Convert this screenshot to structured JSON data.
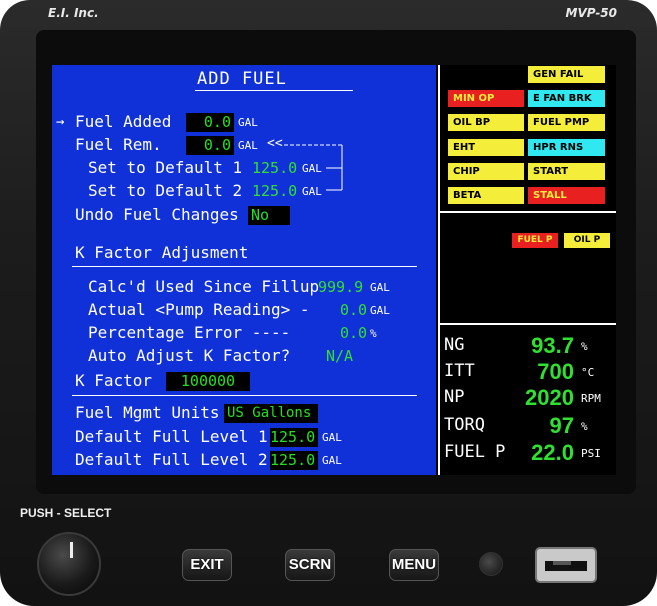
{
  "device": {
    "brand": "E.I. Inc.",
    "model": "MVP-50"
  },
  "screen": {
    "title": "ADD FUEL",
    "fuel_added": {
      "label": "Fuel Added",
      "value": "0.0",
      "unit": "GAL"
    },
    "fuel_rem": {
      "label": "Fuel Rem.",
      "value": "0.0",
      "unit": "GAL"
    },
    "default1": {
      "label": "Set to Default 1",
      "value": "125.0",
      "unit": "GAL"
    },
    "default2": {
      "label": "Set to Default 2",
      "value": "125.0",
      "unit": "GAL"
    },
    "undo": {
      "label": "Undo Fuel Changes",
      "value": "No"
    },
    "k_section": "K Factor Adjusment",
    "calcd": {
      "label": "Calc'd Used Since Fillup",
      "value": "999.9",
      "unit": "GAL"
    },
    "actual": {
      "label": "Actual <Pump Reading> -",
      "value": "0.0",
      "unit": "GAL"
    },
    "pct_err": {
      "label": "Percentage Error ----",
      "value": "0.0",
      "unit": "%"
    },
    "auto_adj": {
      "label": "Auto Adjust K Factor?",
      "value": "N/A"
    },
    "k_factor": {
      "label": "K Factor",
      "value": "100000"
    },
    "units": {
      "label": "Fuel Mgmt Units",
      "value": "US Gallons"
    },
    "full1": {
      "label": "Default Full Level 1",
      "value": "125.0",
      "unit": "GAL"
    },
    "full2": {
      "label": "Default Full Level 2",
      "value": "125.0",
      "unit": "GAL"
    }
  },
  "annunciators": {
    "gen_fail": "GEN FAIL",
    "min_op": "MIN OP",
    "e_fan_brk": "E FAN BRK",
    "oil_bp": "OIL BP",
    "fuel_pmp": "FUEL PMP",
    "eht": "EHT",
    "hpr_rns": "HPR RNS",
    "chip": "CHIP",
    "start": "START",
    "beta": "BETA",
    "stall": "STALL",
    "fuel_p": "FUEL P",
    "oil_p": "OIL P"
  },
  "engine": {
    "ng": {
      "label": "NG",
      "value": "93.7",
      "unit": "%"
    },
    "itt": {
      "label": "ITT",
      "value": "700",
      "unit": "°C"
    },
    "np": {
      "label": "NP",
      "value": "2020",
      "unit": "RPM"
    },
    "torq": {
      "label": "TORQ",
      "value": "97",
      "unit": "%"
    },
    "fuel_p": {
      "label": "FUEL P",
      "value": "22.0",
      "unit": "PSI"
    }
  },
  "controls": {
    "push_select": "PUSH - SELECT",
    "exit": "EXIT",
    "scrn": "SCRN",
    "menu": "MENU"
  },
  "colors": {
    "screen_blue": "#1030d8",
    "value_green": "#30e030",
    "caution_yellow": "#f4ee3a",
    "warning_red": "#e82020",
    "advisory_cyan": "#30e8f0"
  },
  "icons": {
    "selection": "arrow-right-icon",
    "back": "double-chevron-left-icon"
  }
}
